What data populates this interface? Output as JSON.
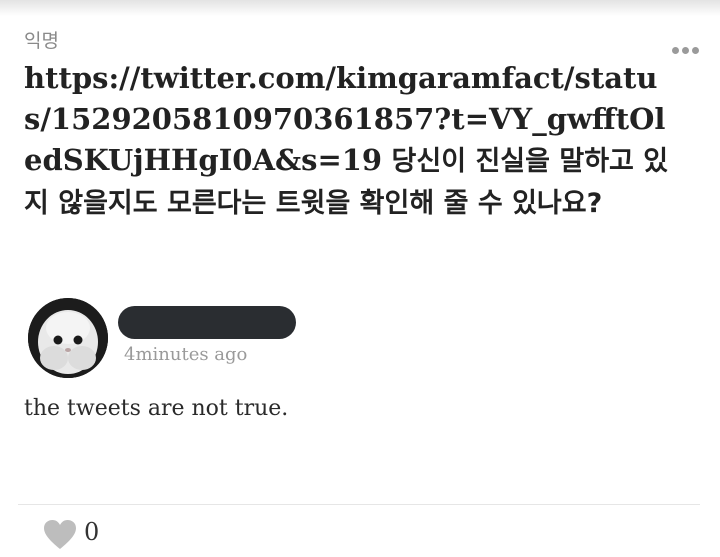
{
  "post": {
    "author": "익명",
    "title_url": "https://twitter.com/kimgaramfact/status/1529205810970361857?t=VY_gwfftOledSKUjHHgI0A&s=19",
    "title_text": " 당신이 진실을 말하고 있지 않을지도 모른다는 트윗을 확인해 줄 수 있나요?"
  },
  "comment": {
    "author_redacted": true,
    "time": "4minutes ago",
    "text": "the tweets are not true."
  },
  "actions": {
    "like_count": "0",
    "like_icon": "heart-icon",
    "more_icon": "more-options-icon"
  },
  "colors": {
    "meta_gray": "#9a9a9a",
    "redaction": "#2a2d31",
    "heart": "#bdbdbd"
  }
}
